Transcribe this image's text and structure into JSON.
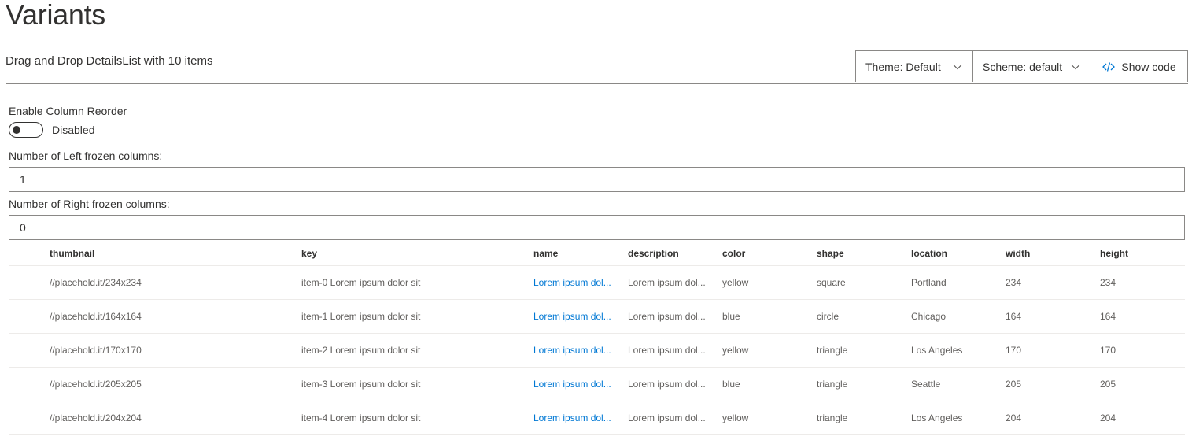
{
  "page": {
    "title": "Variants"
  },
  "section": {
    "title": "Drag and Drop DetailsList with 10 items",
    "theme_dropdown": "Theme: Default",
    "scheme_dropdown": "Scheme: default",
    "show_code": "Show code"
  },
  "controls": {
    "column_reorder_label": "Enable Column Reorder",
    "column_reorder_state": "Disabled",
    "left_frozen_label": "Number of Left frozen columns:",
    "left_frozen_value": "1",
    "right_frozen_label": "Number of Right frozen columns:",
    "right_frozen_value": "0"
  },
  "table": {
    "columns": [
      "thumbnail",
      "key",
      "name",
      "description",
      "color",
      "shape",
      "location",
      "width",
      "height"
    ],
    "rows": [
      [
        "//placehold.it/234x234",
        "item-0 Lorem ipsum dolor sit",
        "Lorem ipsum dol...",
        "Lorem ipsum dol...",
        "yellow",
        "square",
        "Portland",
        "234",
        "234"
      ],
      [
        "//placehold.it/164x164",
        "item-1 Lorem ipsum dolor sit",
        "Lorem ipsum dol...",
        "Lorem ipsum dol...",
        "blue",
        "circle",
        "Chicago",
        "164",
        "164"
      ],
      [
        "//placehold.it/170x170",
        "item-2 Lorem ipsum dolor sit",
        "Lorem ipsum dol...",
        "Lorem ipsum dol...",
        "yellow",
        "triangle",
        "Los Angeles",
        "170",
        "170"
      ],
      [
        "//placehold.it/205x205",
        "item-3 Lorem ipsum dolor sit",
        "Lorem ipsum dol...",
        "Lorem ipsum dol...",
        "blue",
        "triangle",
        "Seattle",
        "205",
        "205"
      ],
      [
        "//placehold.it/204x204",
        "item-4 Lorem ipsum dolor sit",
        "Lorem ipsum dol...",
        "Lorem ipsum dol...",
        "yellow",
        "triangle",
        "Los Angeles",
        "204",
        "204"
      ]
    ]
  },
  "colors": {
    "link": "#0078d4",
    "text": "#323130",
    "secondary_text": "#605e5c",
    "border": "#8a8886",
    "row_divider": "#edebe9"
  },
  "icons": {
    "dropdown": "chevron-down-icon",
    "code": "code-icon"
  }
}
